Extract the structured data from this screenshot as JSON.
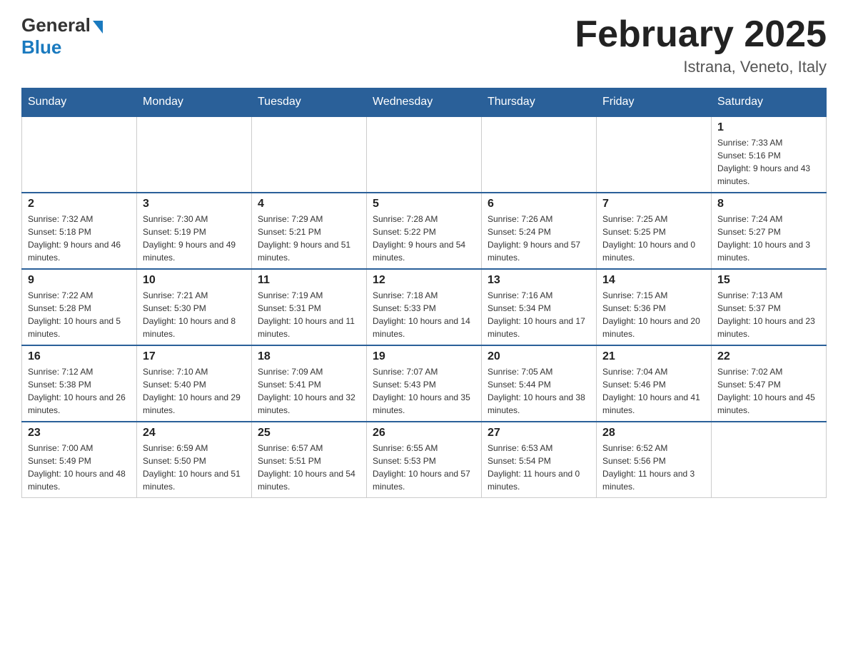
{
  "logo": {
    "general": "General",
    "blue": "Blue"
  },
  "title": "February 2025",
  "location": "Istrana, Veneto, Italy",
  "days_of_week": [
    "Sunday",
    "Monday",
    "Tuesday",
    "Wednesday",
    "Thursday",
    "Friday",
    "Saturday"
  ],
  "weeks": [
    [
      {
        "day": "",
        "info": ""
      },
      {
        "day": "",
        "info": ""
      },
      {
        "day": "",
        "info": ""
      },
      {
        "day": "",
        "info": ""
      },
      {
        "day": "",
        "info": ""
      },
      {
        "day": "",
        "info": ""
      },
      {
        "day": "1",
        "info": "Sunrise: 7:33 AM\nSunset: 5:16 PM\nDaylight: 9 hours and 43 minutes."
      }
    ],
    [
      {
        "day": "2",
        "info": "Sunrise: 7:32 AM\nSunset: 5:18 PM\nDaylight: 9 hours and 46 minutes."
      },
      {
        "day": "3",
        "info": "Sunrise: 7:30 AM\nSunset: 5:19 PM\nDaylight: 9 hours and 49 minutes."
      },
      {
        "day": "4",
        "info": "Sunrise: 7:29 AM\nSunset: 5:21 PM\nDaylight: 9 hours and 51 minutes."
      },
      {
        "day": "5",
        "info": "Sunrise: 7:28 AM\nSunset: 5:22 PM\nDaylight: 9 hours and 54 minutes."
      },
      {
        "day": "6",
        "info": "Sunrise: 7:26 AM\nSunset: 5:24 PM\nDaylight: 9 hours and 57 minutes."
      },
      {
        "day": "7",
        "info": "Sunrise: 7:25 AM\nSunset: 5:25 PM\nDaylight: 10 hours and 0 minutes."
      },
      {
        "day": "8",
        "info": "Sunrise: 7:24 AM\nSunset: 5:27 PM\nDaylight: 10 hours and 3 minutes."
      }
    ],
    [
      {
        "day": "9",
        "info": "Sunrise: 7:22 AM\nSunset: 5:28 PM\nDaylight: 10 hours and 5 minutes."
      },
      {
        "day": "10",
        "info": "Sunrise: 7:21 AM\nSunset: 5:30 PM\nDaylight: 10 hours and 8 minutes."
      },
      {
        "day": "11",
        "info": "Sunrise: 7:19 AM\nSunset: 5:31 PM\nDaylight: 10 hours and 11 minutes."
      },
      {
        "day": "12",
        "info": "Sunrise: 7:18 AM\nSunset: 5:33 PM\nDaylight: 10 hours and 14 minutes."
      },
      {
        "day": "13",
        "info": "Sunrise: 7:16 AM\nSunset: 5:34 PM\nDaylight: 10 hours and 17 minutes."
      },
      {
        "day": "14",
        "info": "Sunrise: 7:15 AM\nSunset: 5:36 PM\nDaylight: 10 hours and 20 minutes."
      },
      {
        "day": "15",
        "info": "Sunrise: 7:13 AM\nSunset: 5:37 PM\nDaylight: 10 hours and 23 minutes."
      }
    ],
    [
      {
        "day": "16",
        "info": "Sunrise: 7:12 AM\nSunset: 5:38 PM\nDaylight: 10 hours and 26 minutes."
      },
      {
        "day": "17",
        "info": "Sunrise: 7:10 AM\nSunset: 5:40 PM\nDaylight: 10 hours and 29 minutes."
      },
      {
        "day": "18",
        "info": "Sunrise: 7:09 AM\nSunset: 5:41 PM\nDaylight: 10 hours and 32 minutes."
      },
      {
        "day": "19",
        "info": "Sunrise: 7:07 AM\nSunset: 5:43 PM\nDaylight: 10 hours and 35 minutes."
      },
      {
        "day": "20",
        "info": "Sunrise: 7:05 AM\nSunset: 5:44 PM\nDaylight: 10 hours and 38 minutes."
      },
      {
        "day": "21",
        "info": "Sunrise: 7:04 AM\nSunset: 5:46 PM\nDaylight: 10 hours and 41 minutes."
      },
      {
        "day": "22",
        "info": "Sunrise: 7:02 AM\nSunset: 5:47 PM\nDaylight: 10 hours and 45 minutes."
      }
    ],
    [
      {
        "day": "23",
        "info": "Sunrise: 7:00 AM\nSunset: 5:49 PM\nDaylight: 10 hours and 48 minutes."
      },
      {
        "day": "24",
        "info": "Sunrise: 6:59 AM\nSunset: 5:50 PM\nDaylight: 10 hours and 51 minutes."
      },
      {
        "day": "25",
        "info": "Sunrise: 6:57 AM\nSunset: 5:51 PM\nDaylight: 10 hours and 54 minutes."
      },
      {
        "day": "26",
        "info": "Sunrise: 6:55 AM\nSunset: 5:53 PM\nDaylight: 10 hours and 57 minutes."
      },
      {
        "day": "27",
        "info": "Sunrise: 6:53 AM\nSunset: 5:54 PM\nDaylight: 11 hours and 0 minutes."
      },
      {
        "day": "28",
        "info": "Sunrise: 6:52 AM\nSunset: 5:56 PM\nDaylight: 11 hours and 3 minutes."
      },
      {
        "day": "",
        "info": ""
      }
    ]
  ]
}
